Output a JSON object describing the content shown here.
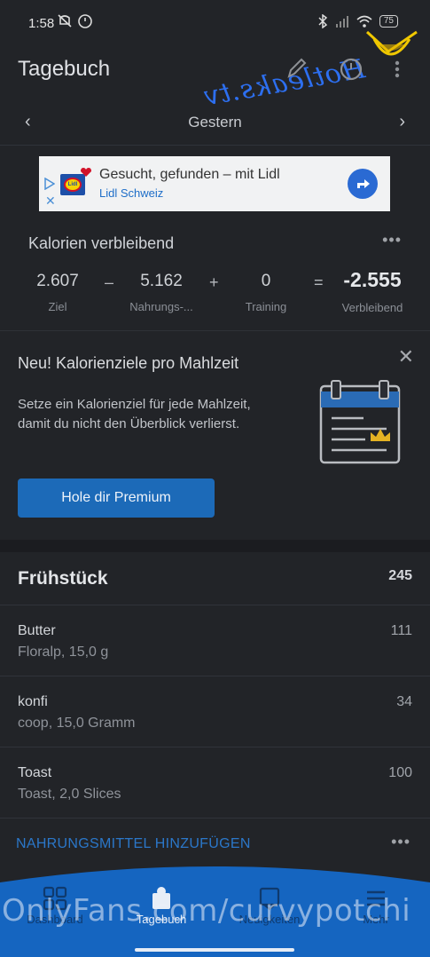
{
  "status": {
    "time": "1:58",
    "battery": "75"
  },
  "appbar": {
    "title": "Tagebuch",
    "watermark": "Hotleaks.tv"
  },
  "date": {
    "label": "Gestern"
  },
  "ad": {
    "title": "Gesucht, gefunden – mit Lidl",
    "subtitle": "Lidl Schweiz",
    "logo_text": "Lidl"
  },
  "calories": {
    "title": "Kalorien verbleibend",
    "goal": {
      "value": "2.607",
      "label": "Ziel"
    },
    "food": {
      "value": "5.162",
      "label": "Nahrungs-..."
    },
    "exercise": {
      "value": "0",
      "label": "Training"
    },
    "remaining": {
      "value": "-2.555",
      "label": "Verbleibend"
    },
    "ops": [
      "–",
      "+",
      "="
    ]
  },
  "promo": {
    "title": "Neu! Kalorienziele pro Mahlzeit",
    "text": "Setze ein Kalorienziel für jede Mahlzeit, damit du nicht den Überblick verlierst.",
    "button": "Hole dir Premium"
  },
  "meal": {
    "name": "Frühstück",
    "total": "245",
    "items": [
      {
        "name": "Butter",
        "desc": "Floralp, 15,0 g",
        "cal": "111"
      },
      {
        "name": "konfi",
        "desc": "coop, 15,0 Gramm",
        "cal": "34"
      },
      {
        "name": "Toast",
        "desc": "Toast, 2,0 Slices",
        "cal": "100"
      }
    ],
    "add_label": "NAHRUNGSMITTEL HINZUFÜGEN"
  },
  "nav": {
    "items": [
      {
        "label": "Dashboard"
      },
      {
        "label": "Tagebuch"
      },
      {
        "label": "Neuigkeiten"
      },
      {
        "label": "Mehr"
      }
    ],
    "watermark": "OnlyFans.com/curvypotchi"
  },
  "colors": {
    "background": "#222428",
    "accent": "#1c6ab8",
    "nav": "#1565c0"
  }
}
